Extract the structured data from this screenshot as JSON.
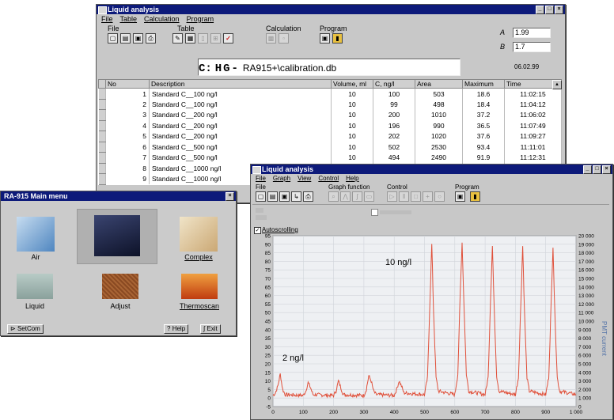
{
  "table_window": {
    "title": "Liquid analysis",
    "menu": [
      "File",
      "Table",
      "Calculation",
      "Program"
    ],
    "toolbar_groups": [
      "File",
      "Table",
      "Calculation",
      "Program"
    ],
    "param_a_label": "A",
    "param_a_value": "1.99",
    "param_b_label": "B",
    "param_b_value": "1.7",
    "path_drive": "C:",
    "path_logo": "HG-",
    "path_rest": "RA915+\\calibration.db",
    "date": "06.02.99",
    "columns": [
      "No",
      "Description",
      "Volume, ml",
      "C, ng/l",
      "Area",
      "Maximum",
      "Time"
    ],
    "rows": [
      [
        "1",
        "Standard C__100 ng/l",
        "10",
        "100",
        "503",
        "18.6",
        "11:02:15"
      ],
      [
        "2",
        "Standard C__100 ng/l",
        "10",
        "99",
        "498",
        "18.4",
        "11:04:12"
      ],
      [
        "3",
        "Standard C__200 ng/l",
        "10",
        "200",
        "1010",
        "37.2",
        "11:06:02"
      ],
      [
        "4",
        "Standard C__200 ng/l",
        "10",
        "196",
        "990",
        "36.5",
        "11:07:49"
      ],
      [
        "5",
        "Standard C__200 ng/l",
        "10",
        "202",
        "1020",
        "37.6",
        "11:09:27"
      ],
      [
        "6",
        "Standard C__500 ng/l",
        "10",
        "502",
        "2530",
        "93.4",
        "11:11:01"
      ],
      [
        "7",
        "Standard C__500 ng/l",
        "10",
        "494",
        "2490",
        "91.9",
        "11:12:31"
      ],
      [
        "8",
        "Standard C__1000 ng/l",
        "",
        "",
        "",
        "",
        ""
      ],
      [
        "9",
        "Standard C__1000 ng/l",
        "",
        "",
        "",
        "",
        ""
      ]
    ]
  },
  "main_menu_window": {
    "title": "RA-915 Main menu",
    "tiles": [
      {
        "label": "Air",
        "color": "#6f9fd0"
      },
      {
        "label": "",
        "color": "#1b2242"
      },
      {
        "label": "Complex",
        "color": "#e6d2a6"
      },
      {
        "label": "Liquid",
        "color": "#9fb6b2"
      },
      {
        "label": "Adjust",
        "color": "#8a4a22"
      },
      {
        "label": "Thermoscan",
        "color": "#e06a22"
      }
    ],
    "setcom_label": "SetCom",
    "help_label": "Help",
    "exit_label": "Exit"
  },
  "graph_window": {
    "title": "Liquid analysis",
    "menu": [
      "File",
      "Graph",
      "View",
      "Control",
      "Help"
    ],
    "toolbar_groups": [
      "File",
      "Graph function",
      "Control",
      "Program"
    ],
    "autoscrolling_label": "Autoscrolling",
    "right_axis_title": "PMT current"
  },
  "chart_data": {
    "type": "line",
    "series": [
      {
        "values": [
          [
            0,
            1.5
          ],
          [
            8,
            3
          ],
          [
            16,
            7
          ],
          [
            24,
            14
          ],
          [
            32,
            5
          ],
          [
            40,
            2
          ],
          [
            100,
            1.5
          ],
          [
            108,
            4
          ],
          [
            116,
            9
          ],
          [
            124,
            6
          ],
          [
            132,
            2
          ],
          [
            200,
            1.5
          ],
          [
            208,
            4
          ],
          [
            216,
            10
          ],
          [
            224,
            6
          ],
          [
            232,
            2
          ],
          [
            300,
            1.5
          ],
          [
            308,
            5
          ],
          [
            316,
            13
          ],
          [
            324,
            10
          ],
          [
            332,
            4
          ],
          [
            340,
            2
          ],
          [
            400,
            1.5
          ],
          [
            408,
            5
          ],
          [
            416,
            10
          ],
          [
            424,
            7
          ],
          [
            432,
            3
          ],
          [
            500,
            2
          ],
          [
            510,
            12
          ],
          [
            518,
            57
          ],
          [
            524,
            90
          ],
          [
            530,
            50
          ],
          [
            538,
            12
          ],
          [
            546,
            4
          ],
          [
            600,
            2
          ],
          [
            610,
            14
          ],
          [
            618,
            62
          ],
          [
            624,
            91
          ],
          [
            630,
            56
          ],
          [
            638,
            14
          ],
          [
            646,
            4
          ],
          [
            700,
            2
          ],
          [
            710,
            12
          ],
          [
            718,
            58
          ],
          [
            724,
            89
          ],
          [
            730,
            52
          ],
          [
            738,
            13
          ],
          [
            746,
            4
          ],
          [
            800,
            2
          ],
          [
            810,
            12
          ],
          [
            818,
            56
          ],
          [
            824,
            89
          ],
          [
            830,
            50
          ],
          [
            838,
            12
          ],
          [
            846,
            4
          ],
          [
            900,
            2
          ],
          [
            910,
            12
          ],
          [
            918,
            56
          ],
          [
            924,
            89
          ],
          [
            930,
            50
          ],
          [
            938,
            12
          ],
          [
            946,
            4
          ],
          [
            1000,
            2
          ]
        ]
      }
    ],
    "annotations": [
      "10 ng/l",
      "2 ng/l"
    ],
    "x_ticks": [
      "0",
      "100",
      "200",
      "300",
      "400",
      "500",
      "600",
      "700",
      "800",
      "900",
      "1 000"
    ],
    "y_ticks": [
      "-5",
      "0",
      "5",
      "10",
      "15",
      "20",
      "25",
      "30",
      "35",
      "40",
      "45",
      "50",
      "55",
      "60",
      "65",
      "70",
      "75",
      "80",
      "85",
      "90",
      "95"
    ],
    "y2_ticks": [
      "0",
      "1 000",
      "2 000",
      "3 000",
      "4 000",
      "5 000",
      "6 000",
      "7 000",
      "8 000",
      "9 000",
      "10 000",
      "11 000",
      "12 000",
      "13 000",
      "14 000",
      "15 000",
      "16 000",
      "17 000",
      "18 000",
      "19 000",
      "20 000"
    ],
    "xlim": [
      0,
      1000
    ],
    "ylim": [
      -5,
      95
    ],
    "y2lim": [
      0,
      20000
    ],
    "line_color": "#e0503a",
    "grid": true
  }
}
